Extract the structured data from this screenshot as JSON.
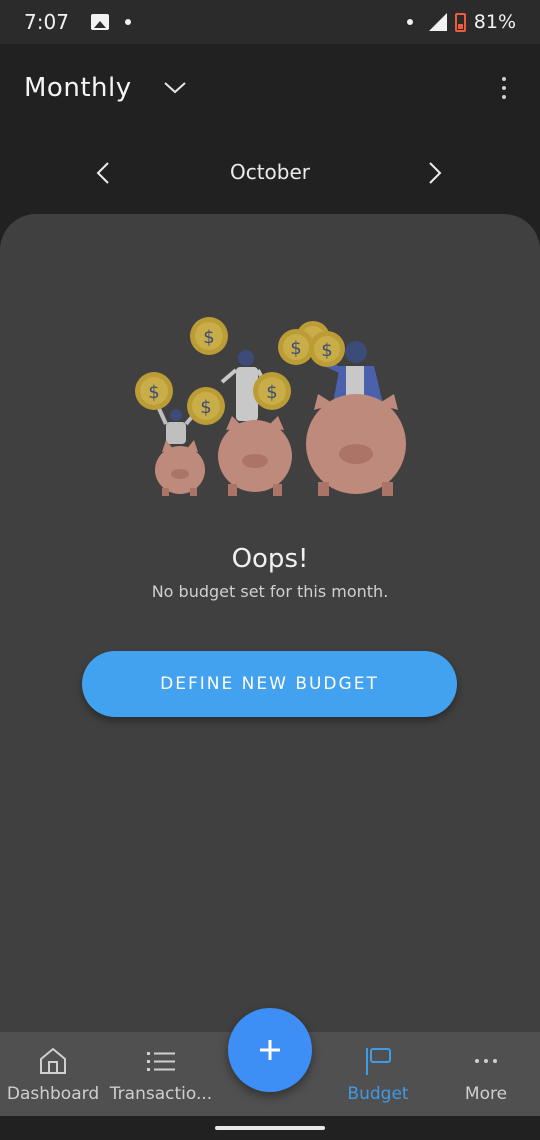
{
  "status_bar": {
    "time": "7:07",
    "battery_percent": "81%",
    "icons": [
      "image-notification-icon",
      "notification-dot-icon",
      "signal-icon",
      "battery-icon"
    ]
  },
  "header": {
    "period": "Monthly",
    "dropdown_icon": "chevron-down-icon",
    "menu_icon": "more-vert-icon"
  },
  "month_nav": {
    "month": "October",
    "prev_icon": "chevron-left-icon",
    "next_icon": "chevron-right-icon"
  },
  "empty_state": {
    "illustration": "piggy-banks-saving-coins",
    "title": "Oops!",
    "subtitle": "No budget set for this month.",
    "button_label": "DEFINE NEW BUDGET"
  },
  "bottom_nav": {
    "items": [
      {
        "label": "Dashboard",
        "icon": "home-icon",
        "active": false
      },
      {
        "label": "Transactio...",
        "icon": "list-icon",
        "active": false
      },
      {
        "label": "Budget",
        "icon": "flag-icon",
        "active": true
      },
      {
        "label": "More",
        "icon": "more-horiz-icon",
        "active": false
      }
    ],
    "fab_icon": "plus-icon"
  },
  "colors": {
    "background": "#212121",
    "panel": "#404040",
    "accent": "#42a2f0",
    "fab": "#3d8ef5",
    "active_nav": "#3f9ae8",
    "nav_bar": "#505050"
  }
}
